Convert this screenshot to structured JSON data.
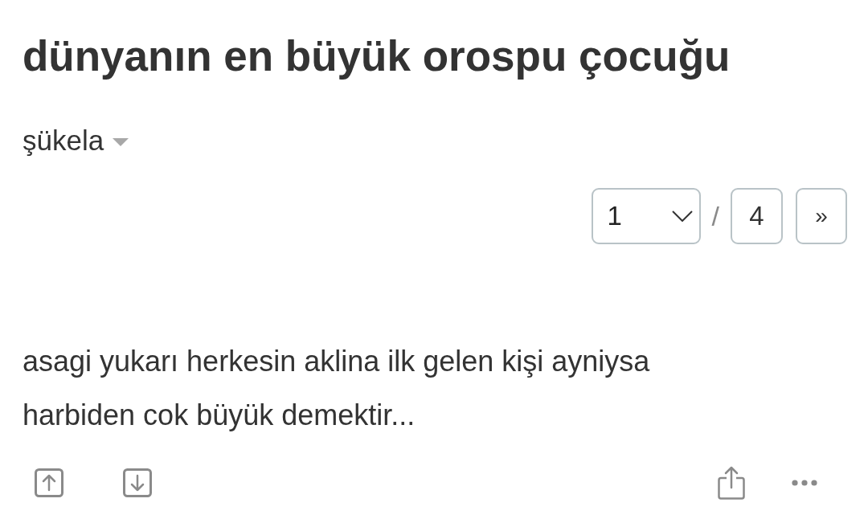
{
  "title": "dünyanın en büyük orospu çocuğu",
  "sort": {
    "label": "şükela"
  },
  "pagination": {
    "current": "1",
    "separator": "/",
    "total": "4",
    "next": "»"
  },
  "entry": {
    "text": "asagi yukarı herkesin aklina ilk gelen kişi ayniysa harbiden cok büyük demektir..."
  }
}
